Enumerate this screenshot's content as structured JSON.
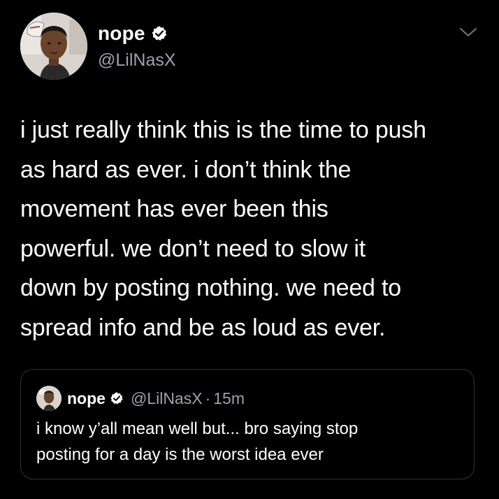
{
  "author": {
    "display_name": "nope",
    "handle": "@LilNasX",
    "verified_icon": "verified-badge-icon",
    "avatar_icon": "profile-avatar"
  },
  "menu": {
    "icon": "chevron-down-icon"
  },
  "tweet": {
    "lines": [
      "i just really think this is the time to push",
      "as hard as ever. i don’t think the",
      "movement has ever been this",
      "powerful. we don’t need to slow it",
      "down by posting nothing. we need to",
      "spread info and be as loud as ever."
    ]
  },
  "quoted_tweet": {
    "display_name": "nope",
    "handle": "@LilNasX",
    "separator": "·",
    "time": "15m",
    "lines": [
      "i know y’all mean well but... bro saying stop",
      "posting for a day is the worst idea ever"
    ]
  },
  "colors": {
    "background": "#000000",
    "text": "#ffffff",
    "secondary_text": "#9aa3ad",
    "card_border": "#2f3336"
  }
}
